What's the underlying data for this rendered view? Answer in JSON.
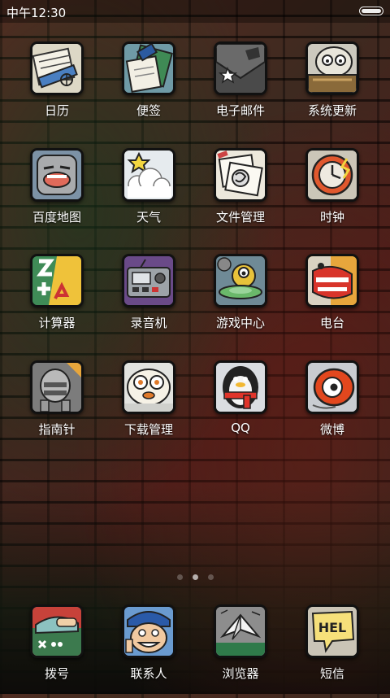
{
  "status_bar": {
    "time": "中午12:30",
    "battery_icon": "battery-icon"
  },
  "apps": [
    {
      "label": "日历",
      "icon": "calendar-icon"
    },
    {
      "label": "便签",
      "icon": "notes-icon"
    },
    {
      "label": "电子邮件",
      "icon": "email-icon"
    },
    {
      "label": "系统更新",
      "icon": "system-update-icon"
    },
    {
      "label": "百度地图",
      "icon": "baidu-map-icon"
    },
    {
      "label": "天气",
      "icon": "weather-icon"
    },
    {
      "label": "文件管理",
      "icon": "file-manager-icon"
    },
    {
      "label": "时钟",
      "icon": "clock-icon"
    },
    {
      "label": "计算器",
      "icon": "calculator-icon"
    },
    {
      "label": "录音机",
      "icon": "recorder-icon"
    },
    {
      "label": "游戏中心",
      "icon": "game-center-icon"
    },
    {
      "label": "电台",
      "icon": "radio-icon"
    },
    {
      "label": "指南针",
      "icon": "compass-icon"
    },
    {
      "label": "下载管理",
      "icon": "download-manager-icon"
    },
    {
      "label": "QQ",
      "icon": "qq-icon"
    },
    {
      "label": "微博",
      "icon": "weibo-icon"
    }
  ],
  "dock": [
    {
      "label": "拨号",
      "icon": "dialer-icon"
    },
    {
      "label": "联系人",
      "icon": "contacts-icon"
    },
    {
      "label": "浏览器",
      "icon": "browser-icon"
    },
    {
      "label": "短信",
      "icon": "messages-icon",
      "bubble_text": "HEL"
    }
  ],
  "page_indicator": {
    "pages": 3,
    "active": 1
  }
}
